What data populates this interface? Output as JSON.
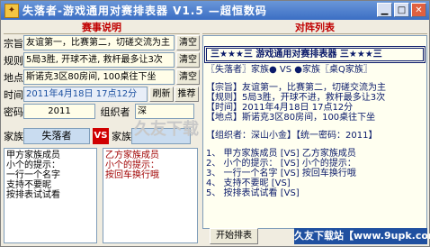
{
  "window": {
    "title": "失落者-游戏通用对赛排表器  V1.5  —超恒数码"
  },
  "left": {
    "header": "赛事说明",
    "purpose": {
      "label": "宗旨",
      "value": "友谊第一，比赛第二，切磋交流为主",
      "btn": "清空"
    },
    "rules": {
      "label": "规则",
      "value": "5局3胜, 开球不进, 救杆最多让3次",
      "btn": "清空"
    },
    "place": {
      "label": "地点",
      "value": "斯诺克3区80房间, 100桌往下坐",
      "btn": "清空"
    },
    "time": {
      "label": "时间",
      "value": "2011年4月18日 17点12分",
      "refresh": "刷新",
      "recommend": "推荐"
    },
    "password": {
      "label": "密码",
      "value": "2011",
      "organizer_label": "组织者",
      "organizer_value": "深"
    },
    "clan": {
      "label": "家族",
      "home": "失落者",
      "vs": "VS",
      "away_label": "家族",
      "away": ""
    },
    "home_members": [
      "甲方家族成员",
      "小个的提示：",
      "一行一个名字",
      "支持不要昵",
      "按排表试试看"
    ],
    "away_members": [
      "乙方家族成员",
      "小个的提示：",
      "按回车换行哦"
    ]
  },
  "right": {
    "header": "对阵列表",
    "banner": "三★★★三  游戏通用对赛排表器  三★★★三",
    "matchline": "〖失落者〗家族●  VS  ●家族〖桌Q家族〗",
    "info": [
      "【宗旨】友谊第一，比赛第二，切磋交流为主",
      "【规则】5局3胜，开球不进，救杆最多让3次",
      "【时间】2011年4月18日 17点12分",
      "【地点】斯诺克3区80房间，100桌往下坐"
    ],
    "org_line": "【组织者：深山小金】【统一密码：2011】",
    "pairs": [
      "1、 甲方家族成员 [VS]  乙方家族成员",
      "2、 小个的提示：  [VS]  小个的提示：",
      "3、 一行一个名字  [VS]  按回车换行哦",
      "4、 支持不要昵  [VS]",
      "5、 按排表试试看  [VS]"
    ],
    "start_btn": "开始排表",
    "watermark": "久友下载"
  },
  "footer": "久友下载站【www.9upk.com】"
}
